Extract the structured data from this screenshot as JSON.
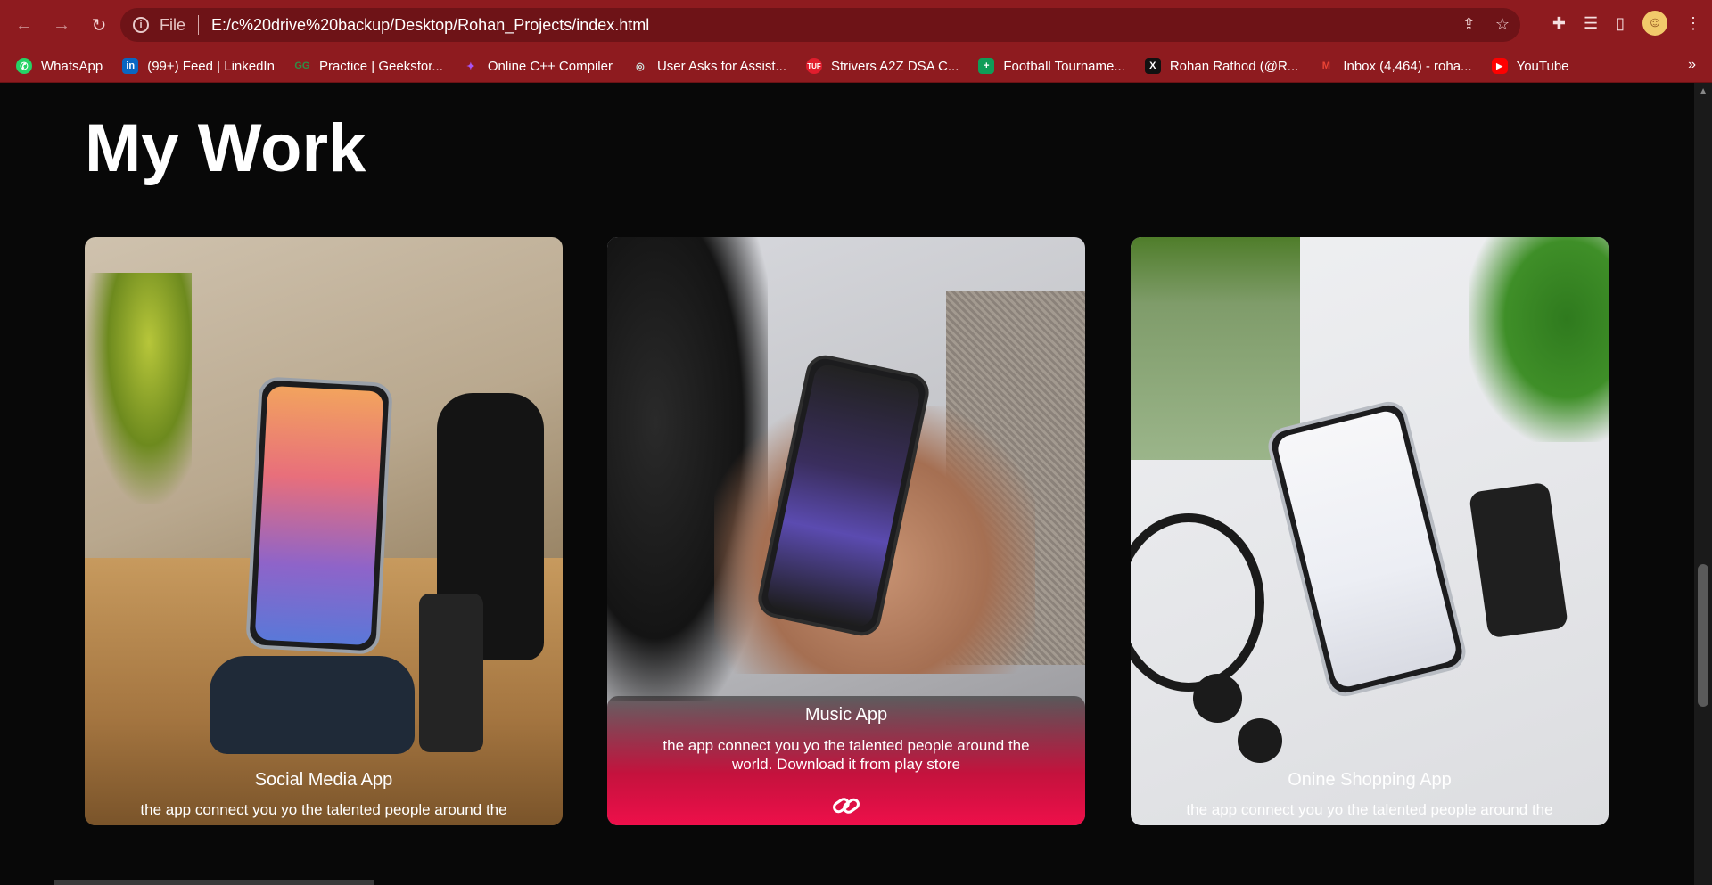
{
  "browser": {
    "file_label": "File",
    "url": "E:/c%20drive%20backup/Desktop/Rohan_Projects/index.html"
  },
  "bookmarks": [
    {
      "label": "WhatsApp",
      "color": "#25d366",
      "glyph": "✆"
    },
    {
      "label": "(99+) Feed | LinkedIn",
      "color": "#0a66c2",
      "glyph": "in"
    },
    {
      "label": "Practice | Geeksfor...",
      "color": "#2f8d46",
      "glyph": "G"
    },
    {
      "label": "Online C++ Compiler",
      "color": "#7c3aed",
      "glyph": "✦"
    },
    {
      "label": "User Asks for Assist...",
      "color": "#74aa9c",
      "glyph": "◎"
    },
    {
      "label": "Strivers A2Z DSA C...",
      "color": "#e11d2d",
      "glyph": "T"
    },
    {
      "label": "Football Tourname...",
      "color": "#0f9d58",
      "glyph": "+"
    },
    {
      "label": "Rohan Rathod (@R...",
      "color": "#111111",
      "glyph": "X"
    },
    {
      "label": "Inbox (4,464) - roha...",
      "color": "#ea4335",
      "glyph": "M"
    },
    {
      "label": "YouTube",
      "color": "#ff0000",
      "glyph": "▶"
    }
  ],
  "page": {
    "heading": "My Work",
    "cards": [
      {
        "title": "Social Media App",
        "description": "the app connect you yo the talented people around the"
      },
      {
        "title": "Music App",
        "description": "the app connect you yo the talented people around the world. Download it from play store"
      },
      {
        "title": "Onine Shopping App",
        "description": "the app connect you yo the talented people around the"
      }
    ]
  }
}
